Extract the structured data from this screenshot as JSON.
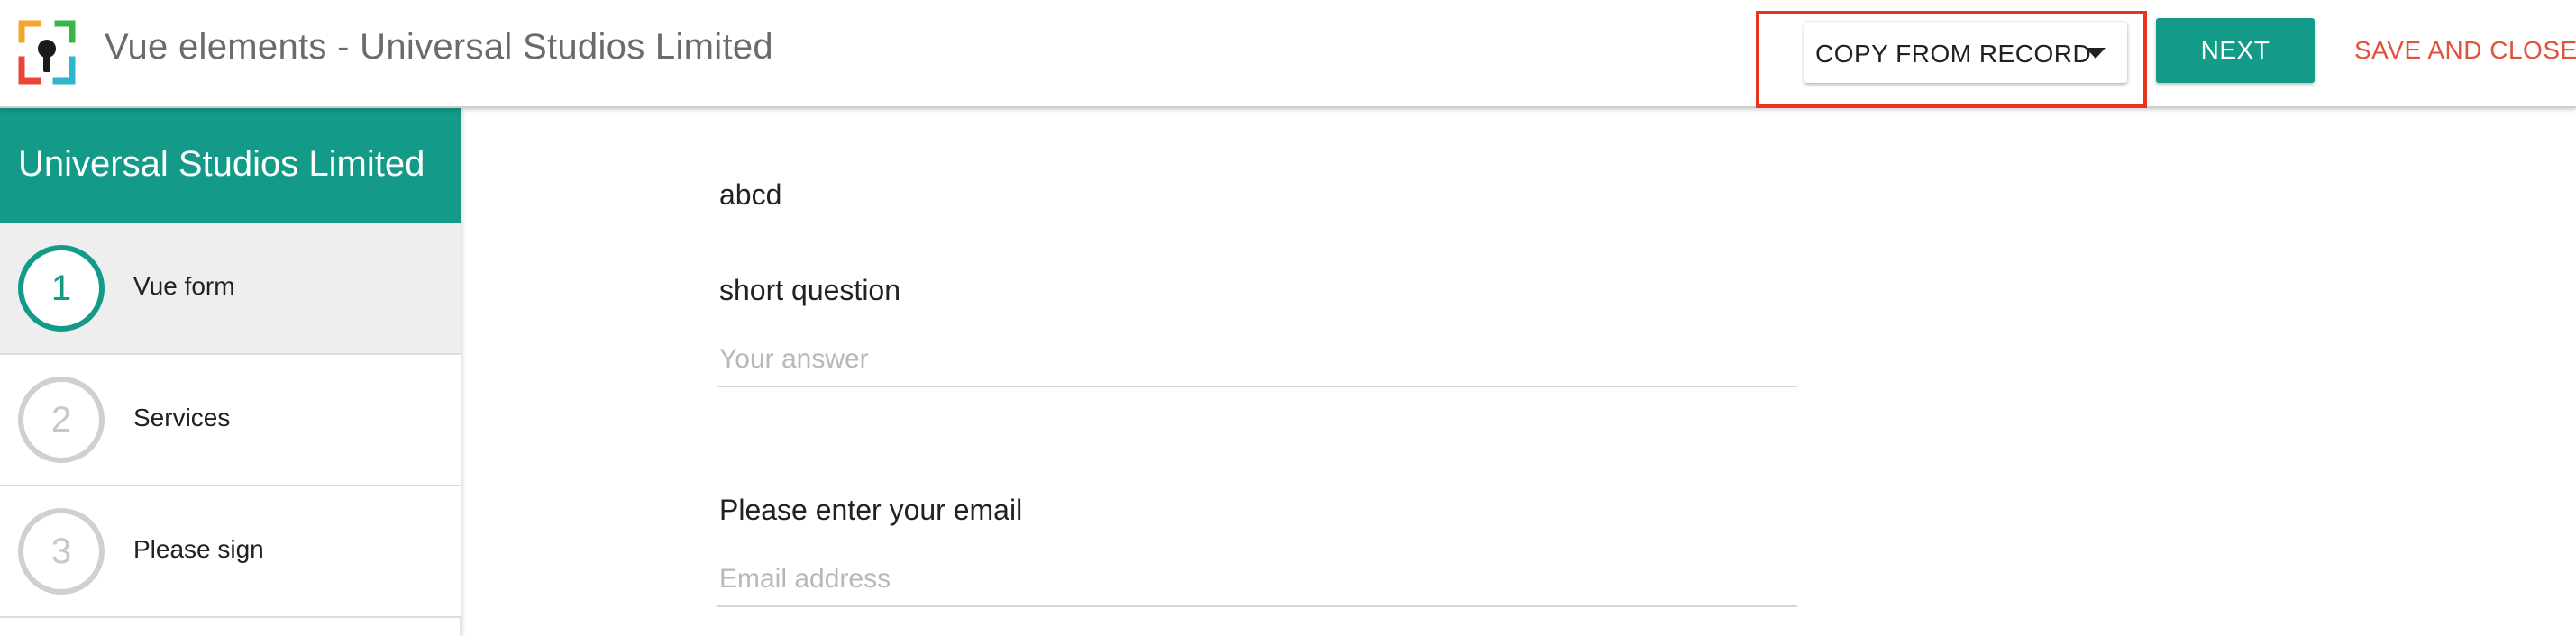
{
  "header": {
    "title": "Vue elements - Universal Studios Limited",
    "copy_from_record_label": "COPY FROM RECORD",
    "next_label": "NEXT",
    "save_close_label": "SAVE AND CLOSE"
  },
  "sidebar": {
    "title": "Universal Studios Limited",
    "steps": [
      {
        "number": "1",
        "label": "Vue form",
        "active": true
      },
      {
        "number": "2",
        "label": "Services",
        "active": false
      },
      {
        "number": "3",
        "label": "Please sign",
        "active": false
      }
    ]
  },
  "form": {
    "heading": "abcd",
    "short_question": {
      "label": "short question",
      "placeholder": "Your answer",
      "value": ""
    },
    "email": {
      "label": "Please enter your email",
      "placeholder": "Email address",
      "value": ""
    }
  },
  "colors": {
    "accent": "#139a88",
    "save_close": "#e0523b",
    "highlight": "#e8351e"
  },
  "icons": {
    "logo": "keyhole-logo-icon",
    "dropdown": "caret-down-icon"
  }
}
